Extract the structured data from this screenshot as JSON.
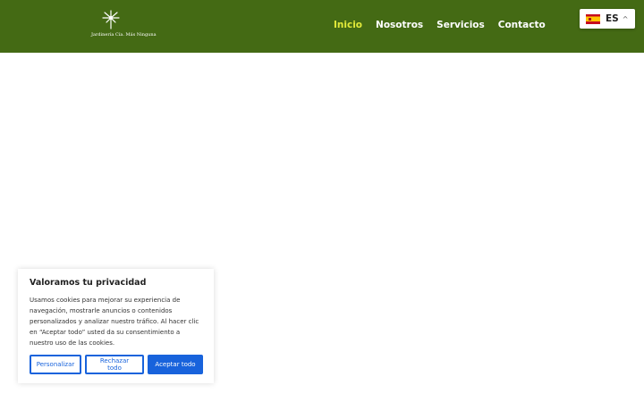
{
  "logo": {
    "text": "Jardinería Cía. Más Ninguna",
    "icon": "palm-tree-icon"
  },
  "nav": {
    "items": [
      {
        "label": "Inicio",
        "active": true
      },
      {
        "label": "Nosotros",
        "active": false
      },
      {
        "label": "Servicios",
        "active": false
      },
      {
        "label": "Contacto",
        "active": false
      }
    ]
  },
  "language": {
    "code": "ES",
    "flag": "spain-flag-icon",
    "caret": "^"
  },
  "cookie": {
    "title": "Valoramos tu privacidad",
    "body": "Usamos cookies para mejorar su experiencia de navegación, mostrarle anuncios o contenidos personalizados y analizar nuestro tráfico. Al hacer clic en “Aceptar todo” usted da su consentimiento a nuestro uso de las cookies.",
    "customize_label": "Personalizar",
    "reject_label": "Rechazar todo",
    "accept_label": "Aceptar todo"
  },
  "colors": {
    "header": "#446a14",
    "active_nav": "#e2ea3a",
    "button": "#1863dc"
  }
}
